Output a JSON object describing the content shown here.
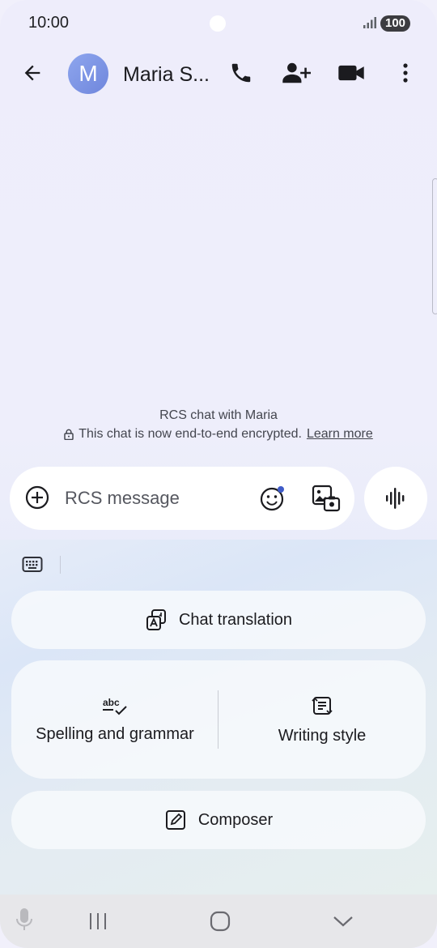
{
  "status_bar": {
    "time": "10:00",
    "battery": "100",
    "icons": [
      "signal-icon",
      "battery-icon"
    ]
  },
  "header": {
    "avatar_letter": "M",
    "contact_name": "Maria S...",
    "icons": [
      "back-arrow-icon",
      "phone-icon",
      "add-person-icon",
      "video-call-icon",
      "more-vert-icon"
    ]
  },
  "conversation": {
    "rcs_title": "RCS chat with Maria",
    "encryption_text": "This chat is now end-to-end encrypted.",
    "learn_more": "Learn more"
  },
  "composer": {
    "placeholder": "RCS message",
    "icons": [
      "add-circle-icon",
      "emoji-icon",
      "gallery-icon",
      "voice-wave-icon"
    ]
  },
  "ai_tools": {
    "chat_translation": "Chat translation",
    "spelling_grammar": "Spelling and grammar",
    "writing_style": "Writing style",
    "composer": "Composer"
  },
  "nav": {
    "icons": [
      "mic-icon",
      "recents-icon",
      "home-icon",
      "back-chevron-icon"
    ]
  },
  "colors": {
    "background": "#eeedfb",
    "avatar": "#7b93e4",
    "accent_dot": "#3f5bc8",
    "nav_bar": "#e7e7ea"
  }
}
